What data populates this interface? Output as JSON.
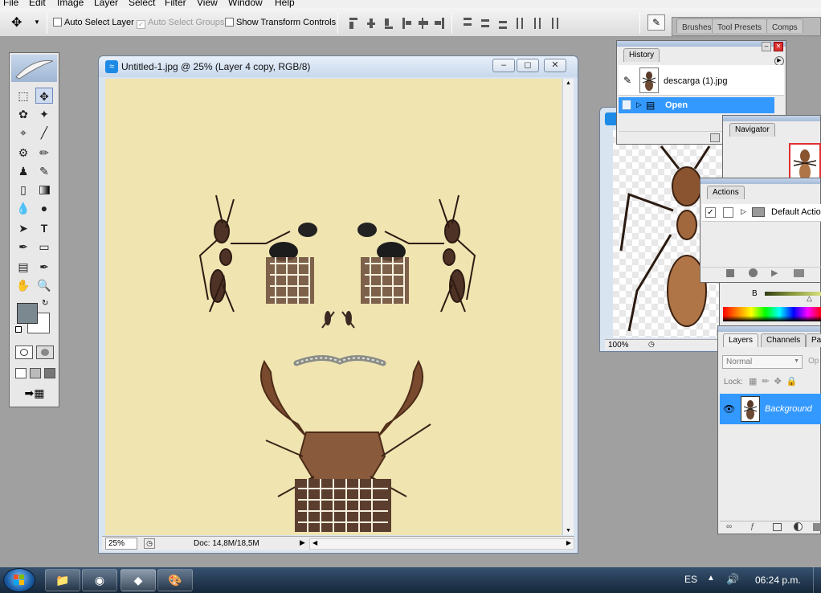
{
  "menu": [
    "File",
    "Edit",
    "Image",
    "Layer",
    "Select",
    "Filter",
    "View",
    "Window",
    "Help"
  ],
  "options": {
    "auto_select_layer": "Auto Select Layer",
    "auto_select_groups": "Auto Select Groups",
    "show_transform_controls": "Show Transform Controls"
  },
  "palette_well": {
    "tabs": [
      "Brushes",
      "Tool Presets",
      "Comps"
    ]
  },
  "document": {
    "title": "Untitled-1.jpg @ 25% (Layer 4 copy, RGB/8)",
    "zoom": "25%",
    "doc_size": "Doc: 14,8M/18,5M",
    "canvas_color": "#f0e4b1"
  },
  "second_window": {
    "zoom": "100%"
  },
  "history": {
    "tab": "History",
    "snapshot": "descarga (1).jpg",
    "step": "Open"
  },
  "navigator": {
    "tab": "Navigator"
  },
  "actions": {
    "tab": "Actions",
    "item": "Default Actions"
  },
  "color": {
    "channel": "B"
  },
  "layers": {
    "tabs": [
      "Layers",
      "Channels",
      "Paths"
    ],
    "blend_mode": "Normal",
    "opacity_label": "Op",
    "lock_label": "Lock:",
    "layer_name": "Background"
  },
  "taskbar": {
    "language": "ES",
    "time": "06:24 p.m."
  },
  "colors": {
    "accent": "#3399ff",
    "selection": "#1d8ae6",
    "foreground": "#7b8890",
    "background": "#ffffff"
  }
}
